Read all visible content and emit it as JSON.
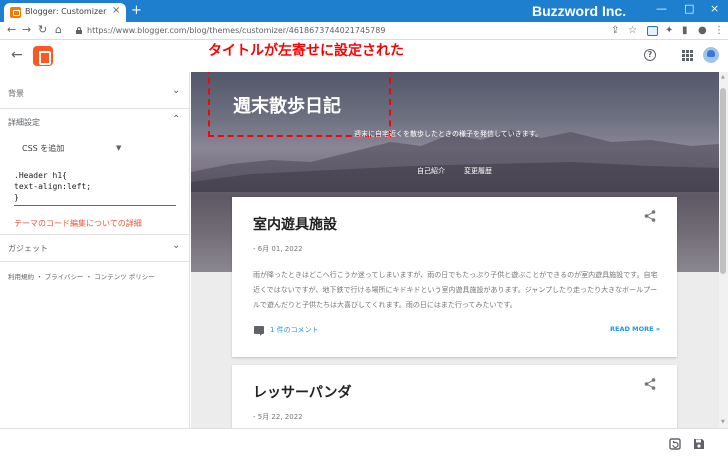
{
  "browser": {
    "tab_title": "Blogger: Customizer",
    "tab_close": "×",
    "new_tab": "+",
    "url": "https://www.blogger.com/blog/themes/customizer/4618673744021745789",
    "brand": "Buzzword Inc.",
    "window_controls": [
      "—",
      "□",
      "×"
    ],
    "nav": [
      "←",
      "→",
      "↻",
      "⌂"
    ]
  },
  "annotation": "タイトルが左寄せに設定された",
  "sidebar": {
    "sections": [
      {
        "label": "背景",
        "expanded": false,
        "chevron": "⌄"
      },
      {
        "label": "詳細設定",
        "expanded": true,
        "chevron": "⌃"
      },
      {
        "label": "ガジェット",
        "expanded": false,
        "chevron": "⌄"
      }
    ],
    "css_select": "CSS を追加",
    "css_select_arrow": "▼",
    "code_lines": [
      ".Header h1{",
      "text-align:left;",
      "}"
    ],
    "code_help_link": "テーマのコード編集についての詳細",
    "footer": "利用規約 ・ プライバシー ・ コンテンツ ポリシー"
  },
  "preview": {
    "blog_title": "週末散歩日記",
    "blog_description": "週末に自宅近くを散歩したときの様子を発信していきます。",
    "page_links": [
      "自己紹介",
      "変更履歴"
    ],
    "posts": [
      {
        "title": "室内遊具施設",
        "date": "- 6月 01, 2022",
        "body": "雨が降ったときはどこへ行こうか迷ってしまいますが、雨の日でもたっぷり子供と遊ぶことができるのが室内遊具施設です。自宅近くではないですが、地下鉄で行ける場所にキドキドという室内遊具施設があります。ジャンプしたり走ったり大きなボールプールで遊んだりと子供たちは大喜びしてくれます。雨の日にはまた行ってみたいです。",
        "comments": "1 件のコメント",
        "read_more": "READ MORE »"
      },
      {
        "title": "レッサーパンダ",
        "date": "- 5月 22, 2022"
      }
    ]
  },
  "icons": {
    "back": "arrow-left-icon",
    "logo": "blogger-logo",
    "help": "help-icon",
    "apps": "apps-grid-icon",
    "share": "share-icon",
    "comment": "comment-icon",
    "revert": "revert-icon",
    "save": "save-icon"
  },
  "colors": {
    "titlebar": "#1e7fcf",
    "accent": "#ff5722",
    "link": "#2196f3",
    "annotation": "#ff0000",
    "help_link": "#e8553c"
  }
}
